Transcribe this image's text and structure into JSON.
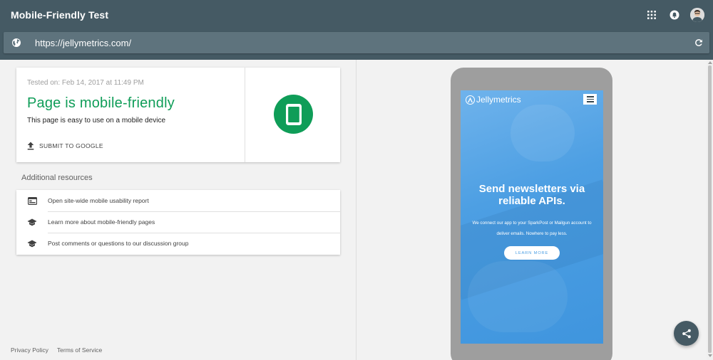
{
  "app": {
    "title": "Mobile-Friendly Test"
  },
  "header": {
    "icons": [
      "apps-grid-icon",
      "notifications-icon",
      "account-avatar"
    ]
  },
  "urlbar": {
    "url": "https://jellymetrics.com/",
    "icons": [
      "globe-icon",
      "refresh-icon"
    ]
  },
  "result": {
    "tested_on": "Tested on: Feb 14, 2017 at 11:49 PM",
    "verdict": "Page is mobile-friendly",
    "verdict_sub": "This page is easy to use on a mobile device",
    "submit_label": "SUBMIT TO GOOGLE",
    "status_color": "#0f9d58"
  },
  "resources": {
    "title": "Additional resources",
    "items": [
      {
        "label": "Open site-wide mobile usability report",
        "icon": "web-report-icon"
      },
      {
        "label": "Learn more about mobile-friendly pages",
        "icon": "school-icon"
      },
      {
        "label": "Post comments or questions to our discussion group",
        "icon": "school-icon"
      }
    ]
  },
  "footer": {
    "privacy": "Privacy Policy",
    "terms": "Terms of Service"
  },
  "preview": {
    "brand": "Jellymetrics",
    "hero_title": "Send newsletters via reliable APIs.",
    "hero_text": "We connect our app to your SparkPost or Mailgun account to deliver emails. Nowhere to pay less.",
    "cta": "LEARN MORE",
    "accent": "#5aa7e8"
  },
  "colors": {
    "appbar": "#455a64",
    "urlbar": "#5e737d",
    "background": "#f2f2f2"
  }
}
